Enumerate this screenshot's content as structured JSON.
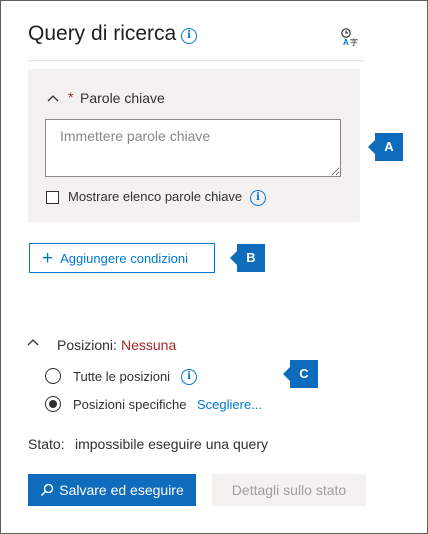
{
  "header": {
    "title": "Query di ricerca",
    "info_icon": "info-icon",
    "translate_icon": "translate-icon"
  },
  "keywords": {
    "required_marker": "*",
    "label": "Parole chiave",
    "placeholder": "Immettere parole chiave",
    "value": "",
    "show_list_label": "Mostrare elenco parole chiave",
    "show_list_checked": false
  },
  "conditions": {
    "add_label": "Aggiungere condizioni"
  },
  "locations": {
    "label": "Posizioni:",
    "value": "Nessuna",
    "options": [
      {
        "label": "Tutte le posizioni",
        "selected": false
      },
      {
        "label": "Posizioni specifiche",
        "selected": true
      }
    ],
    "choose_link": "Scegliere..."
  },
  "status": {
    "label": "Stato:",
    "value": "impossibile eseguire una query"
  },
  "actions": {
    "save_run": "Salvare ed eseguire",
    "status_details": "Dettagli sullo stato"
  },
  "callouts": [
    "A",
    "B",
    "C"
  ],
  "colors": {
    "accent": "#0078d4",
    "callout": "#0f6cbd",
    "required": "#a4262c",
    "panel": "#f3f2f1"
  }
}
